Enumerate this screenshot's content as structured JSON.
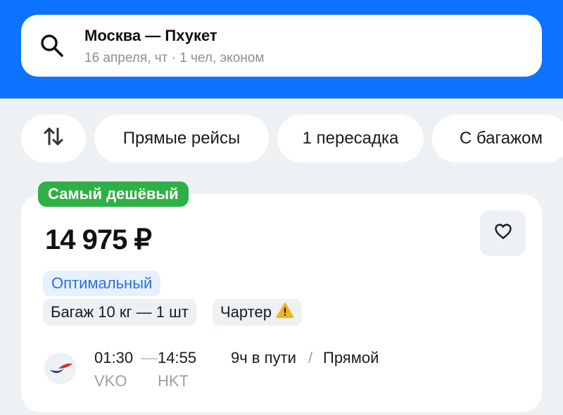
{
  "search": {
    "route": "Москва — Пхукет",
    "details": "16 апреля, чт · 1 чел, эконом",
    "icon": "search-icon"
  },
  "filters": {
    "sort_icon": "sort-icon",
    "chips": [
      "Прямые рейсы",
      "1 пересадка",
      "С багажом"
    ]
  },
  "ticket": {
    "badge": "Самый дешёвый",
    "price": "14 975 ₽",
    "favorite_icon": "heart-icon",
    "tag_optimal": "Оптимальный",
    "tag_baggage": "Багаж 10 кг — 1 шт",
    "tag_charter": "Чартер",
    "warning_icon": "warning-icon",
    "departure_time": "01:30",
    "arrival_time": "14:55",
    "departure_airport": "VKO",
    "arrival_airport": "HKT",
    "duration": "9ч в пути",
    "separator": "/",
    "stops": "Прямой"
  },
  "colors": {
    "header": "#0c73fe",
    "badge": "#2fb046",
    "optimal_tag_bg": "#e6f0ff",
    "optimal_tag_text": "#2f6fe0"
  }
}
